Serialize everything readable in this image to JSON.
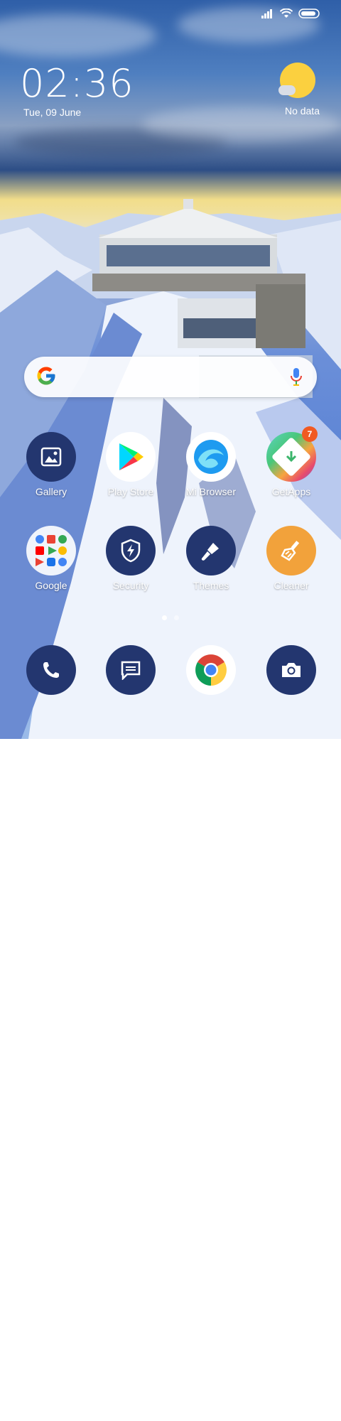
{
  "status_bar": {
    "icons": [
      "signal-icon",
      "wifi-icon",
      "battery-icon"
    ]
  },
  "clock": {
    "time": "02:36",
    "date": "Tue, 09 June"
  },
  "weather": {
    "text": "No data",
    "icon": "sun-cloud-icon"
  },
  "search": {
    "icons": [
      "google-g-icon",
      "microphone-icon"
    ]
  },
  "apps": [
    {
      "label": "Gallery",
      "icon": "gallery-icon"
    },
    {
      "label": "Play Store",
      "icon": "play-store-icon"
    },
    {
      "label": "Mi Browser",
      "icon": "mi-browser-icon"
    },
    {
      "label": "GetApps",
      "icon": "getapps-icon",
      "badge": "7"
    },
    {
      "label": "Google",
      "icon": "google-folder-icon"
    },
    {
      "label": "Security",
      "icon": "security-icon"
    },
    {
      "label": "Themes",
      "icon": "themes-icon"
    },
    {
      "label": "Cleaner",
      "icon": "cleaner-icon"
    }
  ],
  "page_indicator": {
    "pages": 2,
    "active": 1
  },
  "dock": [
    {
      "icon": "phone-icon"
    },
    {
      "icon": "messages-icon"
    },
    {
      "icon": "chrome-icon"
    },
    {
      "icon": "camera-icon"
    }
  ],
  "nav_bar": [
    "recents-button",
    "home-button",
    "back-button"
  ],
  "colors": {
    "icon_navy": "#23366f",
    "badge": "#f15a22",
    "sun": "#fbd03f"
  }
}
